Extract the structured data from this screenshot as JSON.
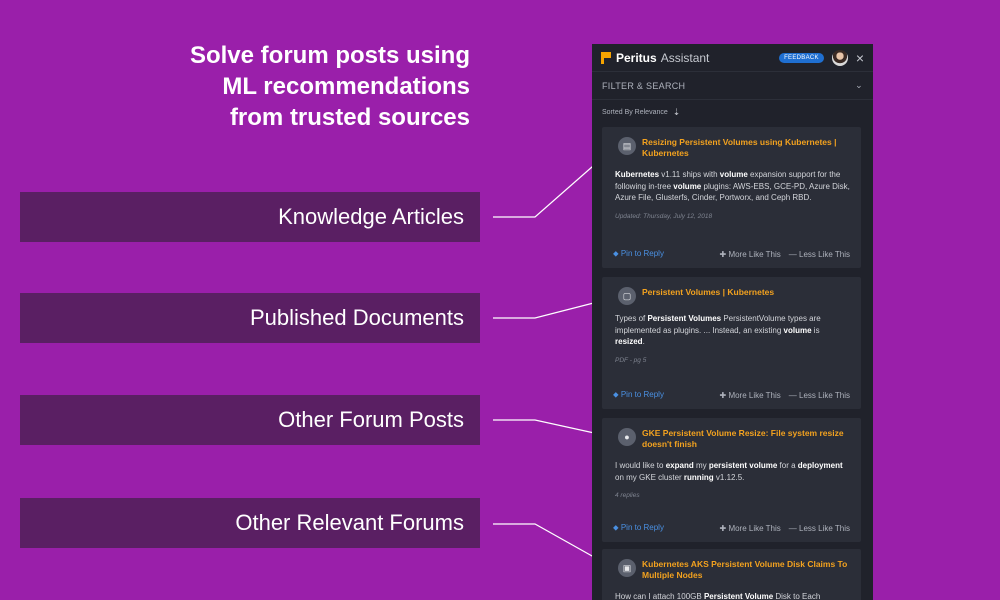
{
  "hero": {
    "line1": "Solve forum posts using",
    "line2": "ML recommendations",
    "line3": "from trusted sources"
  },
  "labels": [
    "Knowledge Articles",
    "Published Documents",
    "Other Forum Posts",
    "Other Relevant Forums"
  ],
  "panel": {
    "brand": "Peritus",
    "assistant": "Assistant",
    "feedback": "FEEDBACK",
    "close": "×",
    "filter": "FILTER & SEARCH",
    "sorted": "Sorted By Relevance"
  },
  "actions": {
    "pin": "Pin to Reply",
    "more": "More Like This",
    "less": "Less Like This"
  },
  "cards": [
    {
      "title": "Resizing Persistent Volumes using Kubernetes | Kubernetes",
      "body": [
        {
          "t": "Kubernetes",
          "b": true
        },
        {
          "t": " v1.11 ships with ",
          "b": false
        },
        {
          "t": "volume",
          "b": true
        },
        {
          "t": " expansion support for the following in-tree ",
          "b": false
        },
        {
          "t": "volume",
          "b": true
        },
        {
          "t": " plugins: AWS-EBS, GCE-PD, Azure Disk, Azure File, Glusterfs, Cinder, Portworx, and Ceph RBD.",
          "b": false
        }
      ],
      "meta": "Updated: Thursday, July 12, 2018"
    },
    {
      "title": "Persistent Volumes | Kubernetes",
      "body": [
        {
          "t": "Types of ",
          "b": false
        },
        {
          "t": "Persistent Volumes",
          "b": true
        },
        {
          "t": " PersistentVolume types are implemented as plugins. ... Instead, an existing ",
          "b": false
        },
        {
          "t": "volume",
          "b": true
        },
        {
          "t": " is ",
          "b": false
        },
        {
          "t": "resized",
          "b": true
        },
        {
          "t": ".",
          "b": false
        }
      ],
      "meta": "PDF - pg 5"
    },
    {
      "title": "GKE Persistent Volume Resize: File system resize doesn't finish",
      "body": [
        {
          "t": "I would like to ",
          "b": false
        },
        {
          "t": "expand",
          "b": true
        },
        {
          "t": " my ",
          "b": false
        },
        {
          "t": "persistent volume",
          "b": true
        },
        {
          "t": " for a ",
          "b": false
        },
        {
          "t": "deployment",
          "b": true
        },
        {
          "t": " on my GKE cluster ",
          "b": false
        },
        {
          "t": "running",
          "b": true
        },
        {
          "t": " v1.12.5.",
          "b": false
        }
      ],
      "meta": "4 replies"
    },
    {
      "title": "Kubernetes AKS Persistent Volume Disk Claims To Multiple Nodes",
      "body": [
        {
          "t": "How can I attach 100GB ",
          "b": false
        },
        {
          "t": "Persistent Volume",
          "b": true
        },
        {
          "t": " Disk to Each",
          "b": false
        }
      ],
      "meta": ""
    }
  ],
  "colors": {
    "background": "#9a1faa",
    "band": "#5a1f63",
    "panel": "#20222b",
    "card": "#2b2e38",
    "accent": "#f3a21f",
    "link": "#4a90e2"
  }
}
